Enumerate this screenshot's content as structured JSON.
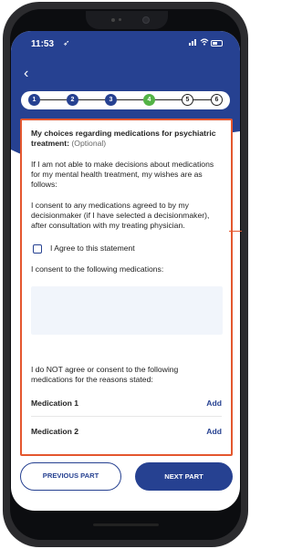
{
  "status_bar": {
    "time": "11:53",
    "location_glyph": "➶"
  },
  "nav": {
    "back_glyph": "‹"
  },
  "stepper": {
    "steps": [
      {
        "label": "1",
        "state": "done"
      },
      {
        "label": "2",
        "state": "done"
      },
      {
        "label": "3",
        "state": "done"
      },
      {
        "label": "4",
        "state": "current"
      },
      {
        "label": "5",
        "state": "todo"
      },
      {
        "label": "6",
        "state": "todo"
      }
    ]
  },
  "card": {
    "heading": "My choices regarding medications for psychiatric treatment:",
    "heading_optional": " (Optional)",
    "intro": "If I am not able to make decisions about medications for my mental health treatment, my wishes are as follows:",
    "consent_statement": "I consent to any medications agreed to by my decisionmaker (if I have selected a decisionmaker), after consultation with my treating physician.",
    "agree_label": "I Agree to this statement",
    "agree_checked": false,
    "consent_meds_label": "I consent to the following medications:",
    "consent_meds_value": "",
    "not_consent_label": "I do NOT agree or consent to the following medications for the reasons stated:",
    "medications": [
      {
        "label": "Medication 1",
        "action": "Add"
      },
      {
        "label": "Medication 2",
        "action": "Add"
      }
    ]
  },
  "footer": {
    "previous_label": "PREVIOUS PART",
    "next_label": "NEXT PART"
  },
  "colors": {
    "primary": "#264191",
    "current_step": "#53b346",
    "highlight_border": "#e4572e"
  }
}
